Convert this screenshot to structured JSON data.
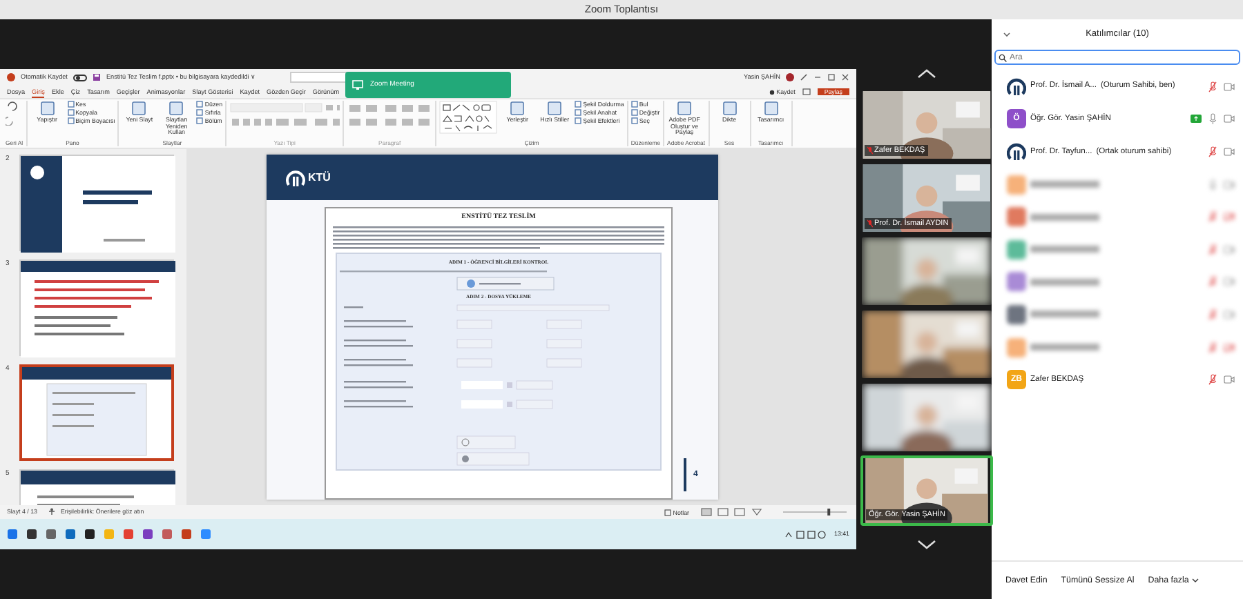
{
  "window": {
    "title": "Zoom Toplantısı"
  },
  "shared_screen": {
    "app_bar": {
      "autosave_label": "Otomatik Kaydet",
      "autosave_on": false,
      "file_title": "Enstitü Tez Teslim f.pptx • bu bilgisayara kaydedildi ∨",
      "user": "Yasin ŞAHİN"
    },
    "notification": {
      "title": "Zoom Meeting"
    },
    "menu_tabs": [
      {
        "label": "Dosya",
        "selected": false
      },
      {
        "label": "Giriş",
        "selected": true
      },
      {
        "label": "Ekle",
        "selected": false
      },
      {
        "label": "Çiz",
        "selected": false
      },
      {
        "label": "Tasarım",
        "selected": false
      },
      {
        "label": "Geçişler",
        "selected": false
      },
      {
        "label": "Animasyonlar",
        "selected": false
      },
      {
        "label": "Slayt Gösterisi",
        "selected": false
      },
      {
        "label": "Kaydet",
        "selected": false
      },
      {
        "label": "Gözden Geçir",
        "selected": false
      },
      {
        "label": "Görünüm",
        "selected": false
      }
    ],
    "record_button": "Kaydet",
    "share_button": "Paylaş",
    "ribbon_groups": [
      {
        "label": "Geri Al",
        "kind": "undo"
      },
      {
        "label": "Pano",
        "kind": "buttons",
        "buttons": [
          {
            "label": "Yapıştır",
            "kind": "large"
          },
          {
            "label": "Kes",
            "kind": "small"
          },
          {
            "label": "Kopyala",
            "kind": "small"
          },
          {
            "label": "Biçim Boyacısı",
            "kind": "small"
          }
        ]
      },
      {
        "label": "Slaytlar",
        "kind": "buttons",
        "buttons": [
          {
            "label": "Yeni Slayt",
            "kind": "large"
          },
          {
            "label": "Slaytları Yeniden Kullan",
            "kind": "large"
          },
          {
            "label": "Düzen",
            "kind": "small"
          },
          {
            "label": "Sıfırla",
            "kind": "small"
          },
          {
            "label": "Bölüm",
            "kind": "small"
          }
        ]
      },
      {
        "label": "Yazı Tipi",
        "kind": "font"
      },
      {
        "label": "Paragraf",
        "kind": "paragraph"
      },
      {
        "label": "Çizim",
        "kind": "shapes",
        "buttons": [
          {
            "label": "Yerleştir",
            "kind": "large"
          },
          {
            "label": "Hızlı Stiller",
            "kind": "large"
          },
          {
            "label": "Şekil Doldurma",
            "kind": "small"
          },
          {
            "label": "Şekil Anahat",
            "kind": "small"
          },
          {
            "label": "Şekil Efektleri",
            "kind": "small"
          }
        ]
      },
      {
        "label": "Düzenleme",
        "kind": "buttons",
        "buttons": [
          {
            "label": "Bul",
            "kind": "small"
          },
          {
            "label": "Değiştir",
            "kind": "small"
          },
          {
            "label": "Seç",
            "kind": "small"
          }
        ]
      },
      {
        "label": "Adobe Acrobat",
        "kind": "buttons",
        "buttons": [
          {
            "label": "Adobe PDF Oluştur ve Paylaş",
            "kind": "large"
          }
        ]
      },
      {
        "label": "Ses",
        "kind": "buttons",
        "buttons": [
          {
            "label": "Dikte",
            "kind": "large"
          }
        ]
      },
      {
        "label": "Tasarımcı",
        "kind": "buttons",
        "buttons": [
          {
            "label": "Tasarımcı",
            "kind": "large"
          }
        ]
      }
    ],
    "thumbnails": [
      {
        "number": "2",
        "selected": false,
        "kind": "title"
      },
      {
        "number": "3",
        "selected": false,
        "kind": "text"
      },
      {
        "number": "4",
        "selected": true,
        "kind": "form"
      },
      {
        "number": "5",
        "selected": false,
        "kind": "header"
      }
    ],
    "slide": {
      "logo_text": "KTÜ",
      "doc_title": "ENSTİTÜ TEZ TESLİM",
      "steps": [
        "ADIM 1 - ÖĞRENCİ BİLGİLERİ KONTROL",
        "ADIM 2 - DOSYA YÜKLEME"
      ],
      "page_number": "4"
    },
    "status_bar": {
      "slide_info": "Slayt 4 / 13",
      "accessibility": "Erişilebilirlik: Önerilere göz atın",
      "notes": "Notlar",
      "zoom": {
        "level": 0.72
      }
    },
    "taskbar": {
      "time": "13:41"
    }
  },
  "video_tiles": [
    {
      "name": "Zafer BEKDAŞ",
      "muted": true
    },
    {
      "name": "Prof. Dr. İsmail AYDIN",
      "muted": true
    },
    {
      "blurred": true
    },
    {
      "blurred": true
    },
    {
      "blurred": true
    },
    {
      "name": "Öğr. Gör. Yasin ŞAHİN",
      "speaking": true
    }
  ],
  "participants": {
    "title": "Katılımcılar (10)",
    "search_placeholder": "Ara",
    "items": [
      {
        "kind": "logo",
        "name": "Prof. Dr. İsmail A...",
        "role": "(Oturum Sahibi, ben)",
        "muted": true,
        "video_stopped": false
      },
      {
        "kind": "initial",
        "name": "Öğr. Gör. Yasin ŞAHİN",
        "initials": "Ö",
        "color": "#8e4fc9",
        "muted": false,
        "sharing": true,
        "video_stopped": false
      },
      {
        "kind": "logo",
        "name": "Prof. Dr. Tayfun...",
        "role": "(Ortak oturum sahibi)",
        "muted": true,
        "video_stopped": false
      },
      {
        "kind": "blurred",
        "color": "#f6b17a",
        "muted": false,
        "video_stopped": false
      },
      {
        "kind": "blurred",
        "color": "#e07a5f",
        "muted": true,
        "video_stopped": true
      },
      {
        "kind": "blurred",
        "color": "#5dbb9a",
        "muted": true,
        "video_stopped": false
      },
      {
        "kind": "blurred",
        "color": "#a98bd6",
        "muted": true,
        "video_stopped": false
      },
      {
        "kind": "blurred",
        "color": "#6e7480",
        "muted": true,
        "video_stopped": false
      },
      {
        "kind": "blurred",
        "color": "#f6b17a",
        "muted": true,
        "video_stopped": true
      },
      {
        "kind": "initial",
        "name": "Zafer BEKDAŞ",
        "initials": "ZB",
        "color": "#f2a516",
        "muted": true,
        "video_stopped": false
      }
    ]
  },
  "footer_buttons": [
    {
      "label": "Davet Edin"
    },
    {
      "label": "Tümünü Sessize Al"
    },
    {
      "label": "Daha fazla",
      "caret": true
    }
  ]
}
